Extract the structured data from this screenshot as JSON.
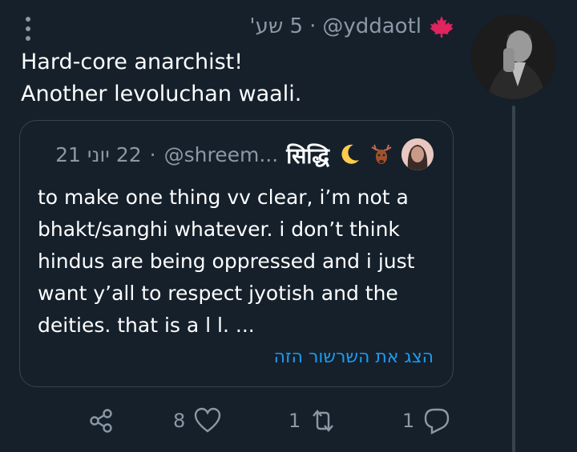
{
  "tweet": {
    "handle": "@yddaotl",
    "time": "5 שע'",
    "separator": "·",
    "lines": [
      "Hard-core anarchist!",
      "Another levoluchan waali."
    ]
  },
  "quoted": {
    "date": "22 יוני 21",
    "handle": "@shreem...",
    "name": "सिद्धि",
    "text": "to make one thing vv clear, i’m not a bhakt/sanghi whatever. i don’t think hindus are being oppressed and i just want y’all to respect jyotish and the deities. that is a l l. ...",
    "show_thread": "הצג את השרשור הזה"
  },
  "actions": {
    "likes": "8",
    "retweets": "1",
    "replies": "1"
  },
  "colors": {
    "background": "#15202b",
    "muted": "#8b98a5",
    "link": "#1d9bf0",
    "border": "#38444d"
  }
}
